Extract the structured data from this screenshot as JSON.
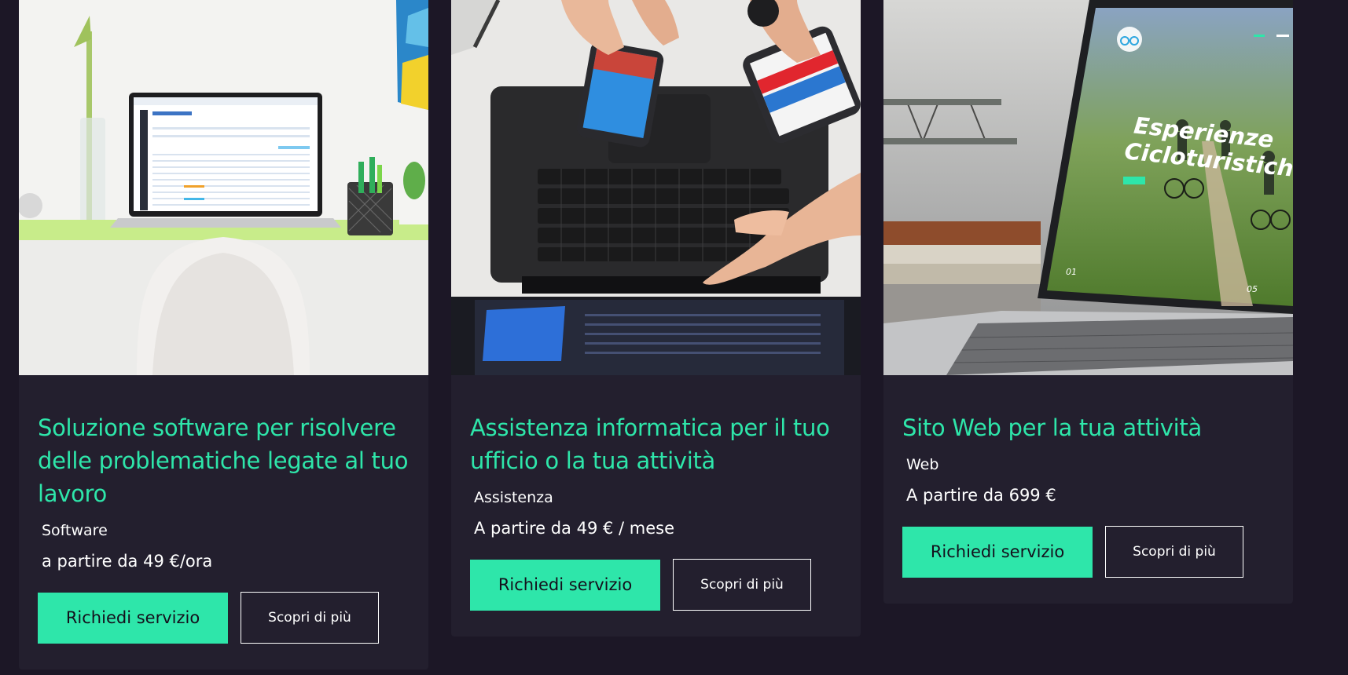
{
  "cards": [
    {
      "title": "Soluzione software per risolvere delle problematiche legate al tuo lavoro",
      "category": "Software",
      "price": "a partire da 49 €/ora",
      "primary_button": "Richiedi servizio",
      "secondary_button": "Scopri di più",
      "image": "laptop-on-desk-photo"
    },
    {
      "title": "Assistenza informatica per il tuo ufficio o la tua attività",
      "category": "Assistenza",
      "price": "A partire da 49 € / mese",
      "primary_button": "Richiedi servizio",
      "secondary_button": "Scopri di più",
      "image": "hands-phones-keyboard-photo"
    },
    {
      "title": "Sito Web per la tua attività",
      "category": "Web",
      "price": "A partire da 699 €",
      "primary_button": "Richiedi servizio",
      "secondary_button": "Scopri di più",
      "image": "laptop-website-photo",
      "screen_text": {
        "headline_1": "Esperienze",
        "headline_2": "Cicloturistiche",
        "slide_start": "01",
        "slide_end": "05"
      }
    }
  ],
  "colors": {
    "page_background": "#1c1726",
    "card_background": "#231f2e",
    "accent": "#2ee6aa",
    "text": "#ffffff"
  }
}
